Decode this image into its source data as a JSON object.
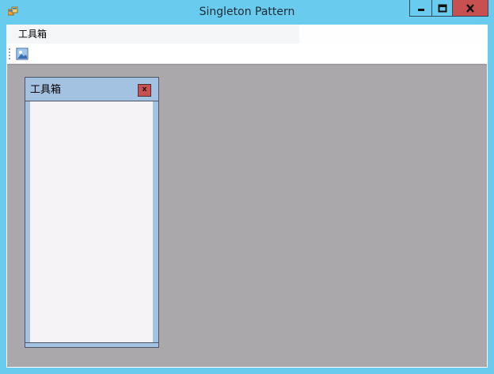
{
  "window": {
    "title": "Singleton Pattern",
    "icon": "app-forms-icon",
    "controls": [
      "minimize-icon",
      "maximize-icon",
      "close-icon"
    ],
    "frame_color": "#69cbee",
    "close_color": "#c75050"
  },
  "menubar": {
    "items": [
      {
        "label": "工具箱"
      }
    ]
  },
  "toolbar": {
    "buttons": [
      {
        "icon": "image-icon"
      }
    ]
  },
  "mdi": {
    "background": "#aaa8ab",
    "child": {
      "title": "工具箱",
      "close_label": "x",
      "header_color": "#a3c1e1"
    }
  }
}
